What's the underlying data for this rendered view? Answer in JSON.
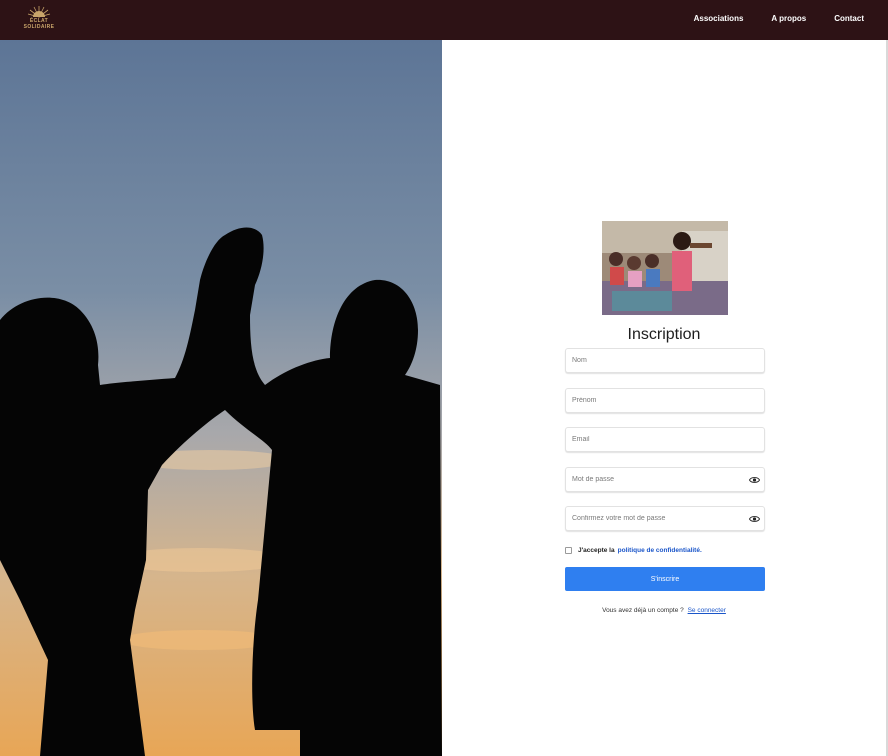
{
  "brand": {
    "name": "ÉCLAT SOLIDAIRE",
    "accent_color": "#c9a56a"
  },
  "nav": {
    "background": "#2d1215",
    "links": [
      "Associations",
      "A propos",
      "Contact"
    ]
  },
  "hero": {
    "image": "silhouettes-sunset"
  },
  "form": {
    "thumbnail": "children-classroom-photo",
    "title": "Inscription",
    "fields": {
      "nom": {
        "placeholder": "Nom",
        "value": ""
      },
      "prenom": {
        "placeholder": "Prénom",
        "value": ""
      },
      "email": {
        "placeholder": "Email",
        "value": ""
      },
      "password": {
        "placeholder": "Mot de passe",
        "value": "",
        "icon": "eye-icon"
      },
      "confirm": {
        "placeholder": "Confirmez votre mot de passe",
        "value": "",
        "icon": "eye-icon"
      }
    },
    "consent": {
      "prefix": "J'accepte la",
      "link": "politique de confidentialité."
    },
    "submit_label": "S'inscrire",
    "login": {
      "prefix": "Vous avez déjà un compte ?",
      "link": "Se connecter"
    },
    "button_color": "#2f7ff0",
    "link_color": "#1a55c9"
  }
}
